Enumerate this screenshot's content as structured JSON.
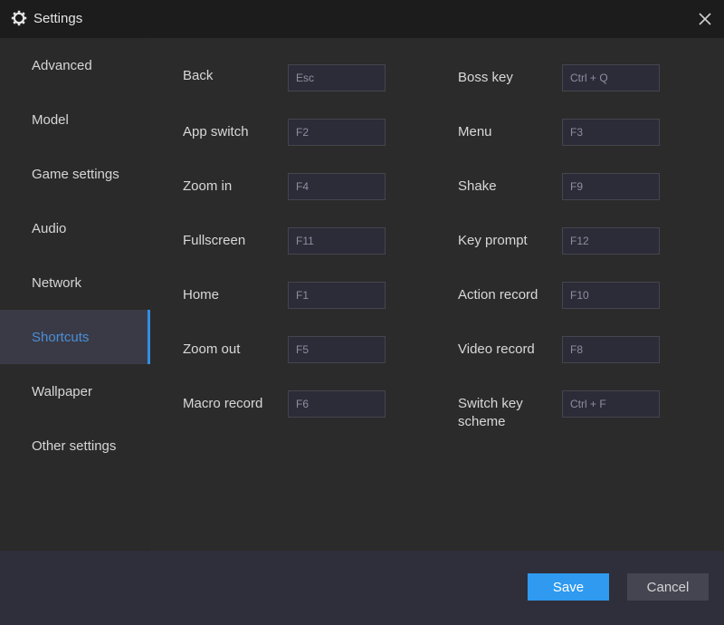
{
  "window": {
    "title": "Settings"
  },
  "sidebar": {
    "items": [
      {
        "label": "Advanced"
      },
      {
        "label": "Model"
      },
      {
        "label": "Game settings"
      },
      {
        "label": "Audio"
      },
      {
        "label": "Network"
      },
      {
        "label": "Shortcuts",
        "active": true
      },
      {
        "label": "Wallpaper"
      },
      {
        "label": "Other settings"
      }
    ]
  },
  "shortcuts": {
    "left": [
      {
        "label": "Back",
        "key": "Esc"
      },
      {
        "label": "App switch",
        "key": "F2"
      },
      {
        "label": "Zoom in",
        "key": "F4"
      },
      {
        "label": "Fullscreen",
        "key": "F11"
      },
      {
        "label": "Home",
        "key": "F1"
      },
      {
        "label": "Zoom out",
        "key": "F5"
      },
      {
        "label": "Macro record",
        "key": "F6"
      }
    ],
    "right": [
      {
        "label": "Boss key",
        "key": "Ctrl + Q"
      },
      {
        "label": "Menu",
        "key": "F3"
      },
      {
        "label": "Shake",
        "key": "F9"
      },
      {
        "label": "Key prompt",
        "key": "F12"
      },
      {
        "label": "Action record",
        "key": "F10"
      },
      {
        "label": "Video record",
        "key": "F8"
      },
      {
        "label": "Switch key scheme",
        "key": "Ctrl + F"
      }
    ]
  },
  "footer": {
    "save_label": "Save",
    "cancel_label": "Cancel"
  },
  "colors": {
    "accent": "#2f9af0",
    "active_text": "#4a8fd6",
    "background": "#2b2b2b"
  }
}
